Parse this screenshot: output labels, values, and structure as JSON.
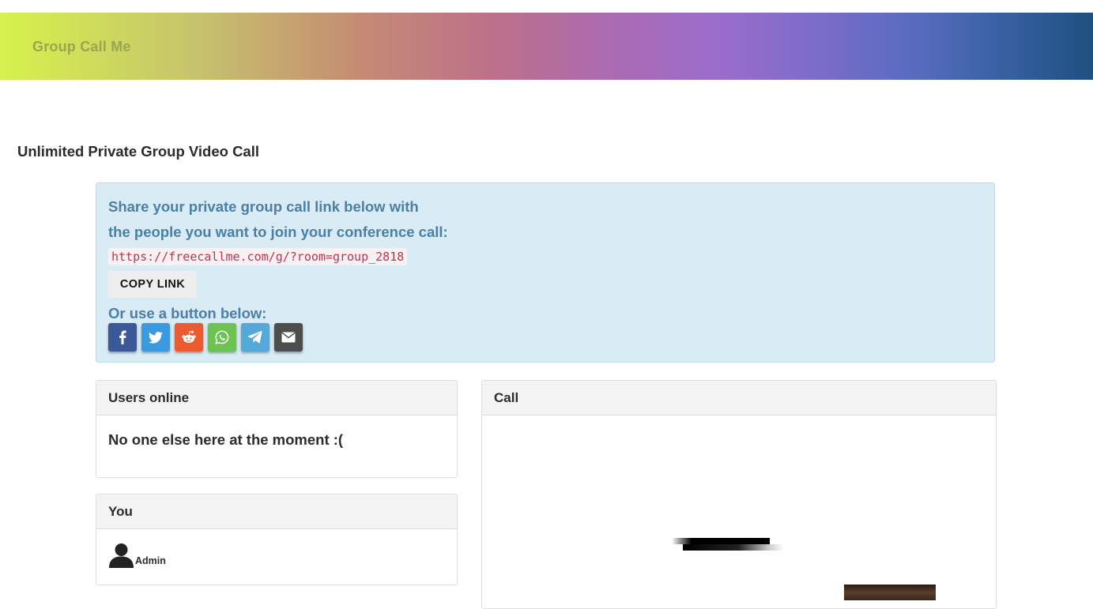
{
  "header": {
    "brand": "Group Call Me"
  },
  "page": {
    "title": "Unlimited Private Group Video Call"
  },
  "share": {
    "line1": "Share your private group call link below with",
    "line2": "the people you want to join your conference call:",
    "link": "https://freecallme.com/g/?room=group_2818",
    "copy_label": "COPY LINK",
    "or_use": "Or use a button below:",
    "buttons": [
      {
        "name": "facebook",
        "icon": "facebook-icon",
        "color": "#3b5998"
      },
      {
        "name": "twitter",
        "icon": "twitter-icon",
        "color": "#3b99df"
      },
      {
        "name": "reddit",
        "icon": "reddit-icon",
        "color": "#ec5a32"
      },
      {
        "name": "whatsapp",
        "icon": "whatsapp-icon",
        "color": "#6cc351"
      },
      {
        "name": "telegram",
        "icon": "telegram-icon",
        "color": "#54a9d9"
      },
      {
        "name": "email",
        "icon": "envelope-icon",
        "color": "#4d4d4d"
      }
    ]
  },
  "users_panel": {
    "heading": "Users online",
    "empty_message": "No one else here at the moment :("
  },
  "you_panel": {
    "heading": "You",
    "name": "Admin",
    "icon": "user-silhouette-icon"
  },
  "call_panel": {
    "heading": "Call"
  },
  "colors": {
    "accent_text": "#4a7fa8",
    "share_bg": "#d9ebf4",
    "code_text": "#c0334e"
  }
}
